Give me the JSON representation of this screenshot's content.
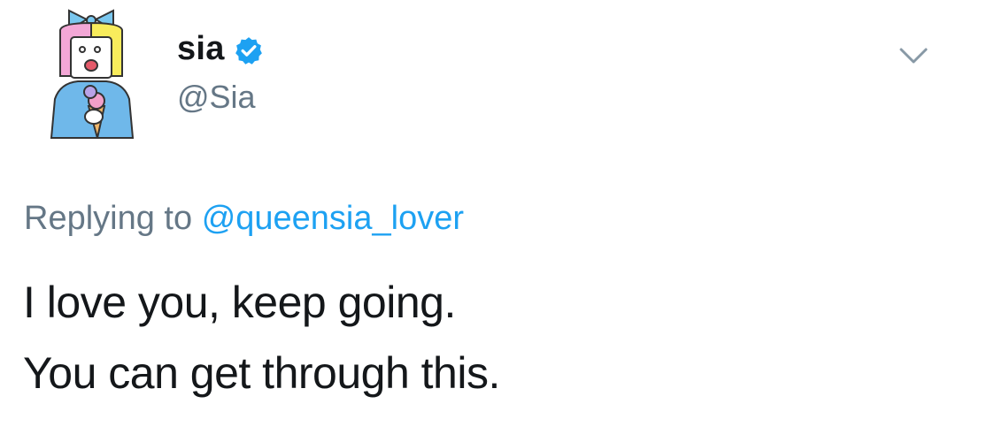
{
  "author": {
    "display_name": "sia",
    "handle": "@Sia",
    "verified": true
  },
  "reply": {
    "prefix": "Replying to",
    "mention": "@queensia_lover"
  },
  "tweet": {
    "lines": [
      "I love you, keep going.",
      "You can get through this."
    ]
  },
  "icons": {
    "verified": "verified-badge-icon",
    "caret": "chevron-down-icon"
  },
  "colors": {
    "verified_blue": "#1da1f2",
    "secondary_text": "#657786",
    "mention_blue": "#1da1f2",
    "primary_text": "#14171a"
  }
}
